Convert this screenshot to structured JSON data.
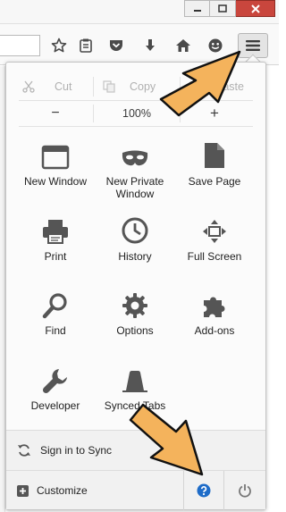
{
  "toolbar": {
    "buttons": [
      {
        "name": "bookmark-star-button",
        "icon": "star-icon"
      },
      {
        "name": "reading-list-button",
        "icon": "clipboard-icon"
      },
      {
        "name": "pocket-button",
        "icon": "pocket-icon"
      },
      {
        "name": "downloads-button",
        "icon": "download-arrow-icon"
      },
      {
        "name": "home-button",
        "icon": "home-icon"
      },
      {
        "name": "hello-button",
        "icon": "smiley-icon"
      }
    ],
    "menu_icon": "hamburger-icon"
  },
  "edit": {
    "cut": "Cut",
    "copy": "Copy",
    "paste": "Paste"
  },
  "zoom": {
    "minus": "−",
    "value": "100%",
    "plus": "+"
  },
  "tiles": [
    {
      "label": "New Window",
      "icon": "window-icon"
    },
    {
      "label": "New Private\nWindow",
      "icon": "mask-icon"
    },
    {
      "label": "Save Page",
      "icon": "document-icon"
    },
    {
      "label": "Print",
      "icon": "printer-icon"
    },
    {
      "label": "History",
      "icon": "clock-icon"
    },
    {
      "label": "Full Screen",
      "icon": "fullscreen-arrows-icon"
    },
    {
      "label": "Find",
      "icon": "magnifier-icon"
    },
    {
      "label": "Options",
      "icon": "gear-icon"
    },
    {
      "label": "Add-ons",
      "icon": "puzzle-icon"
    },
    {
      "label": "Developer",
      "icon": "wrench-icon"
    },
    {
      "label": "Synced Tabs",
      "icon": "synced-tabs-icon"
    }
  ],
  "footer": {
    "sync_label": "Sign in to Sync",
    "customize_label": "Customize"
  },
  "colors": {
    "accent_orange": "#F4B35C",
    "help_blue": "#1E6CC8"
  }
}
